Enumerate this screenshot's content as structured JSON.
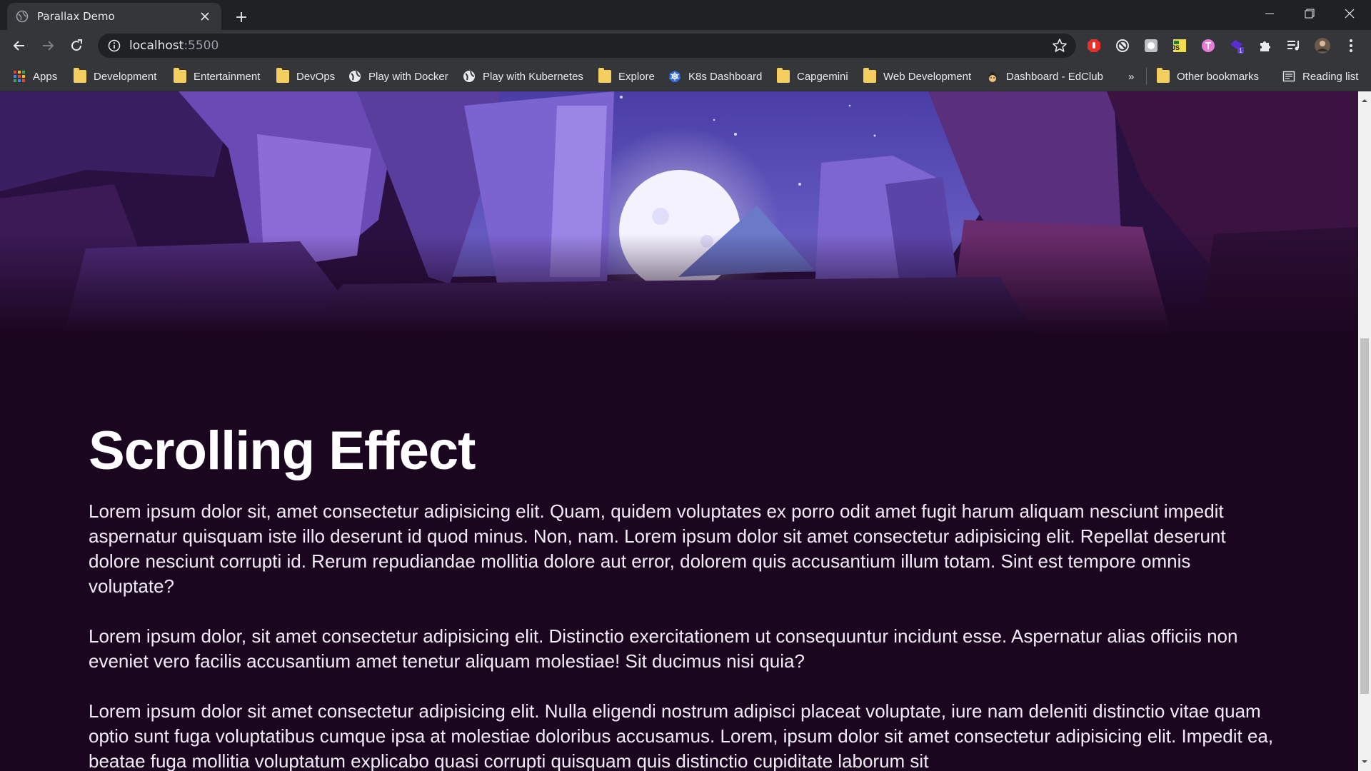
{
  "browser": {
    "tab_title": "Parallax Demo",
    "url_host": "localhost",
    "url_port": ":5500"
  },
  "bookmarks": [
    {
      "label": "Apps",
      "icon": "apps-grid-icon"
    },
    {
      "label": "Development",
      "icon": "folder-icon"
    },
    {
      "label": "Entertainment",
      "icon": "folder-icon"
    },
    {
      "label": "DevOps",
      "icon": "folder-icon"
    },
    {
      "label": "Play with Docker",
      "icon": "globe-icon"
    },
    {
      "label": "Play with Kubernetes",
      "icon": "globe-icon"
    },
    {
      "label": "Explore",
      "icon": "folder-icon"
    },
    {
      "label": "K8s Dashboard",
      "icon": "kubernetes-icon"
    },
    {
      "label": "Capgemini",
      "icon": "folder-icon"
    },
    {
      "label": "Web Development",
      "icon": "folder-icon"
    },
    {
      "label": "Dashboard - EdClub",
      "icon": "edclub-icon"
    },
    {
      "label": "»",
      "icon": "chevron-more-icon"
    },
    {
      "label": "Other bookmarks",
      "icon": "folder-icon"
    },
    {
      "label": "Reading list",
      "icon": "reading-list-icon"
    }
  ],
  "page": {
    "heading": "Scrolling Effect",
    "paragraphs": [
      "Lorem ipsum dolor sit, amet consectetur adipisicing elit. Quam, quidem voluptates ex porro odit amet fugit harum aliquam nesciunt impedit aspernatur quisquam iste illo deserunt id quod minus. Non, nam. Lorem ipsum dolor sit amet consectetur adipisicing elit. Repellat deserunt dolore nesciunt corrupti id. Rerum repudiandae mollitia dolore aut error, dolorem quis accusantium illum totam. Sint est tempore omnis voluptate?",
      "Lorem ipsum dolor, sit amet consectetur adipisicing elit. Distinctio exercitationem ut consequuntur incidunt esse. Aspernatur alias officiis non eveniet vero facilis accusantium amet tenetur aliquam molestiae! Sit ducimus nisi quia?",
      "Lorem ipsum dolor sit amet consectetur adipisicing elit. Nulla eligendi nostrum adipisci placeat voluptate, iure nam deleniti distinctio vitae quam optio sunt fuga voluptatibus cumque ipsa at molestiae doloribus accusamus. Lorem, ipsum dolor sit amet consectetur adipisicing elit. Impedit ea, beatae fuga mollitia voluptatum explicabo quasi corrupti quisquam quis distinctio cupiditate laborum sit"
    ]
  },
  "colors": {
    "page_background": "#1b0620",
    "sky": "#5a4bb0",
    "moon": "#f4f2ff",
    "rock": "#7a5cc4"
  }
}
